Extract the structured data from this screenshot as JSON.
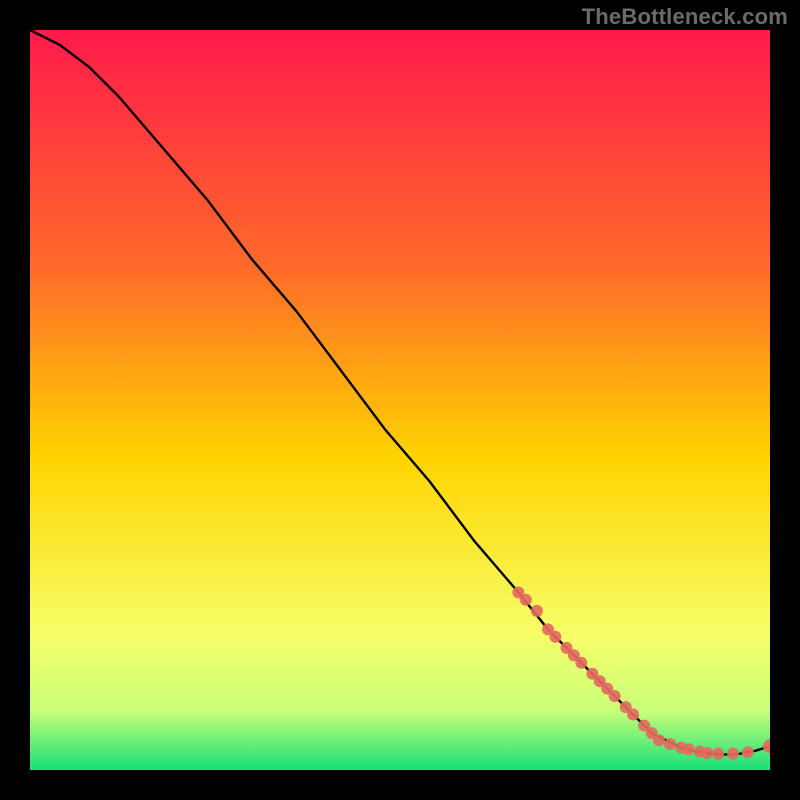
{
  "watermark": "TheBottleneck.com",
  "chart_data": {
    "type": "line",
    "title": "",
    "xlabel": "",
    "ylabel": "",
    "xlim": [
      0,
      100
    ],
    "ylim": [
      0,
      100
    ],
    "grid": false,
    "legend": false,
    "colors": {
      "gradient_top": "#ff1a4b",
      "gradient_mid_upper": "#ff6a2a",
      "gradient_mid": "#ffd400",
      "gradient_lower": "#f6ff6a",
      "gradient_bottom": "#17e07a",
      "line": "#000000",
      "markers": "#e46a5e"
    },
    "curve": {
      "x": [
        0,
        4,
        8,
        12,
        18,
        24,
        30,
        36,
        42,
        48,
        54,
        60,
        66,
        70,
        74,
        78,
        82,
        84,
        86,
        88,
        90,
        92,
        94,
        96,
        98,
        100
      ],
      "y": [
        100,
        98,
        95,
        91,
        84,
        77,
        69,
        62,
        54,
        46,
        39,
        31,
        24,
        19,
        15,
        11,
        7,
        5,
        4,
        3,
        2.5,
        2.2,
        2.1,
        2.2,
        2.6,
        3.2
      ]
    },
    "series": [
      {
        "name": "markers",
        "x": [
          66,
          67,
          68.5,
          70,
          71,
          72.5,
          73.5,
          74.5,
          76,
          77,
          78,
          79,
          80.5,
          81.5,
          83,
          84,
          85,
          86.5,
          88,
          89,
          90.5,
          91.5,
          93,
          95,
          97,
          100
        ],
        "y": [
          24,
          23,
          21.5,
          19,
          18,
          16.5,
          15.5,
          14.5,
          13,
          12,
          11,
          10,
          8.5,
          7.5,
          6,
          5,
          4,
          3.5,
          3,
          2.8,
          2.5,
          2.3,
          2.2,
          2.2,
          2.4,
          3.2
        ]
      }
    ]
  }
}
